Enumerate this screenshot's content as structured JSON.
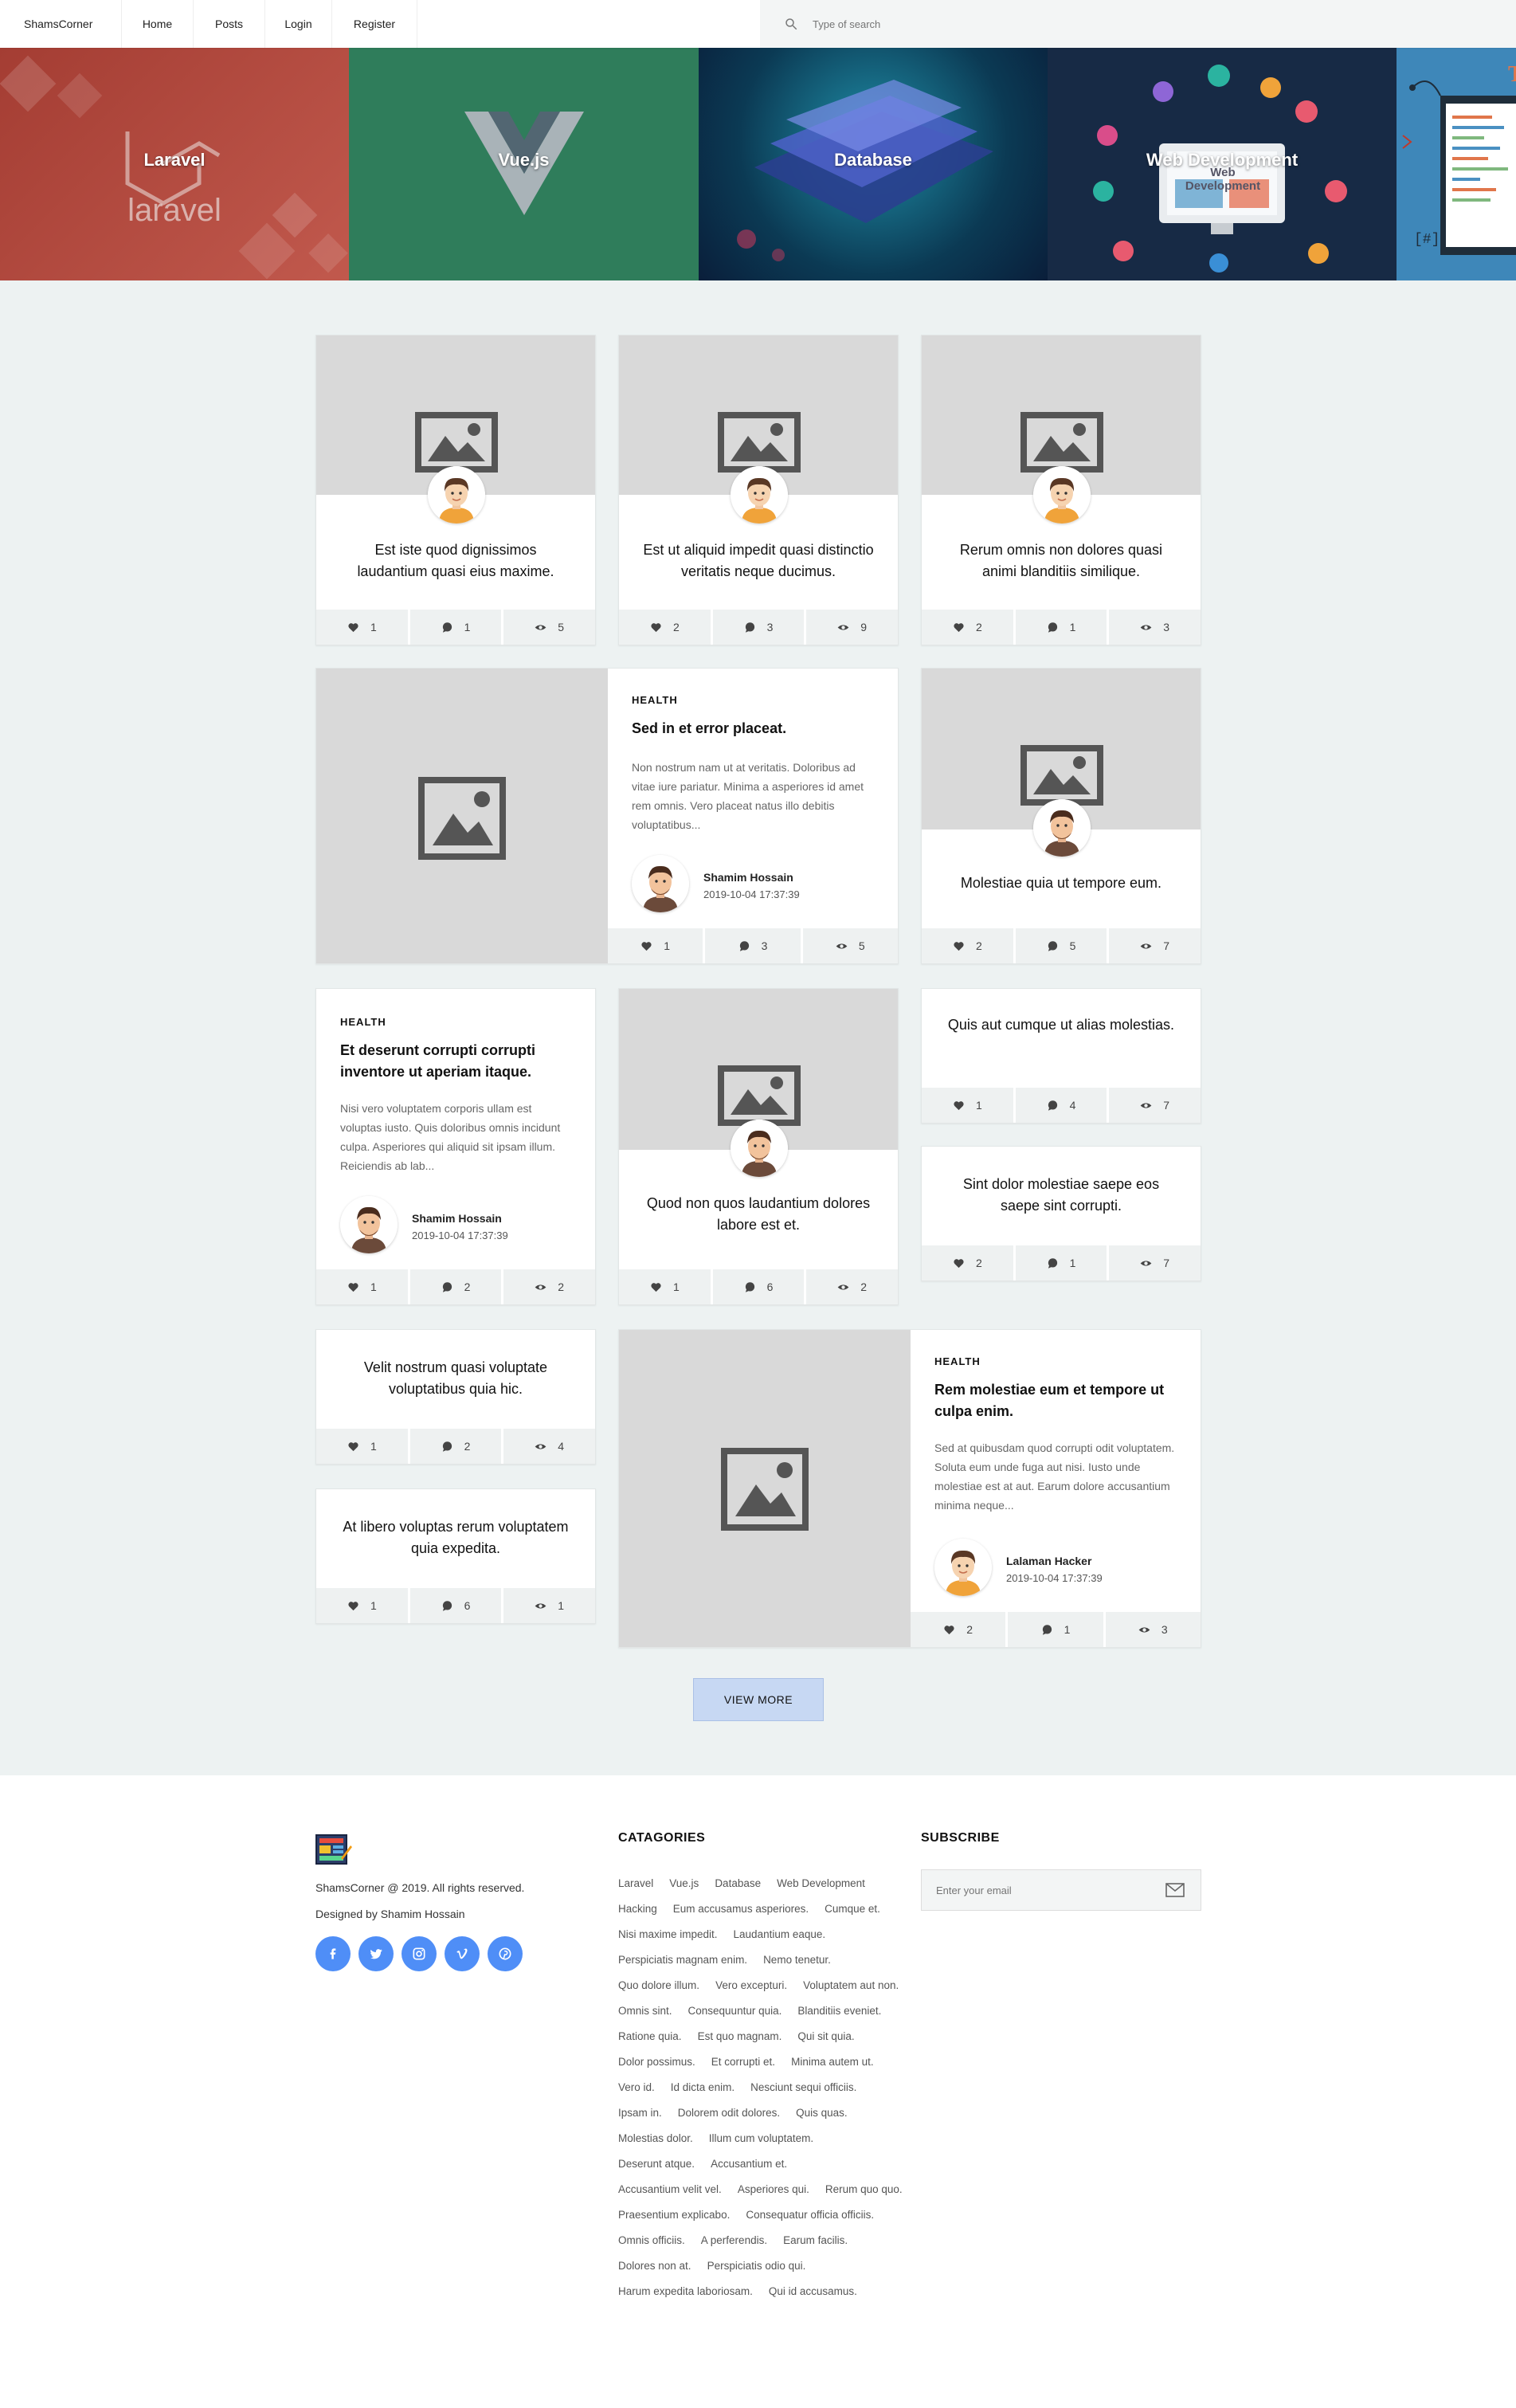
{
  "nav": {
    "brand": "ShamsCorner",
    "items": [
      "Home",
      "Posts",
      "Login",
      "Register"
    ],
    "search_placeholder": "Type of search"
  },
  "hero": {
    "tiles": [
      {
        "label": "Laravel",
        "logo_text": "laravel"
      },
      {
        "label": "Vue.js"
      },
      {
        "label": "Database"
      },
      {
        "label": "Web Development",
        "screen_text": "Web Development"
      },
      {
        "label": ""
      }
    ]
  },
  "posts": [
    {
      "title": "Est iste quod dignissimos laudantium quasi eius maxime.",
      "likes": "1",
      "comments": "1",
      "views": "5"
    },
    {
      "title": "Est ut aliquid impedit quasi distinctio veritatis neque ducimus.",
      "likes": "2",
      "comments": "3",
      "views": "9"
    },
    {
      "title": "Rerum omnis non dolores quasi animi blanditiis similique.",
      "likes": "2",
      "comments": "1",
      "views": "3"
    },
    {
      "category": "HEALTH",
      "title": "Sed in et error placeat.",
      "excerpt": "Non nostrum nam ut at veritatis. Doloribus ad vitae iure pariatur. Minima a asperiores id amet rem omnis. Vero placeat natus illo debitis voluptatibus...",
      "author": "Shamim Hossain",
      "date": "2019-10-04 17:37:39",
      "likes": "1",
      "comments": "3",
      "views": "5"
    },
    {
      "title": "Molestiae quia ut tempore eum.",
      "likes": "2",
      "comments": "5",
      "views": "7"
    },
    {
      "category": "HEALTH",
      "title": "Et deserunt corrupti corrupti inventore ut aperiam itaque.",
      "excerpt": "Nisi vero voluptatem corporis ullam est voluptas iusto. Quis doloribus omnis incidunt culpa. Asperiores qui aliquid sit ipsam illum. Reiciendis ab lab...",
      "author": "Shamim Hossain",
      "date": "2019-10-04 17:37:39",
      "likes": "1",
      "comments": "2",
      "views": "2"
    },
    {
      "title": "Quod non quos laudantium dolores labore est et.",
      "likes": "1",
      "comments": "6",
      "views": "2"
    },
    {
      "title": "Quis aut cumque ut alias molestias.",
      "likes": "1",
      "comments": "4",
      "views": "7"
    },
    {
      "title": "Sint dolor molestiae saepe eos saepe sint corrupti.",
      "likes": "2",
      "comments": "1",
      "views": "7"
    },
    {
      "title": "Velit nostrum quasi voluptate voluptatibus quia hic.",
      "likes": "1",
      "comments": "2",
      "views": "4"
    },
    {
      "title": "At libero voluptas rerum voluptatem quia expedita.",
      "likes": "1",
      "comments": "6",
      "views": "1"
    },
    {
      "category": "HEALTH",
      "title": "Rem molestiae eum et tempore ut culpa enim.",
      "excerpt": "Sed at quibusdam quod corrupti odit voluptatem. Soluta eum unde fuga aut nisi. Iusto unde molestiae est at aut. Earum dolore accusantium minima neque...",
      "author": "Lalaman Hacker",
      "date": "2019-10-04 17:37:39",
      "likes": "2",
      "comments": "1",
      "views": "3"
    }
  ],
  "view_more_label": "VIEW MORE",
  "footer": {
    "copyright": "ShamsCorner @ 2019. All rights reserved.",
    "designed_by": "Designed by Shamim Hossain",
    "social_icons": [
      "facebook-icon",
      "twitter-icon",
      "instagram-icon",
      "vimeo-icon",
      "pinterest-icon"
    ],
    "categories_heading": "CATAGORIES",
    "categories": [
      "Laravel",
      "Vue.js",
      "Database",
      "Web Development",
      "Hacking",
      "Eum accusamus asperiores.",
      "Cumque et.",
      "Nisi maxime impedit.",
      "Laudantium eaque.",
      "Perspiciatis magnam enim.",
      "Nemo tenetur.",
      "Quo dolore illum.",
      "Vero excepturi.",
      "Voluptatem aut non.",
      "Omnis sint.",
      "Consequuntur quia.",
      "Blanditiis eveniet.",
      "Ratione quia.",
      "Est quo magnam.",
      "Qui sit quia.",
      "Dolor possimus.",
      "Et corrupti et.",
      "Minima autem ut.",
      "Vero id.",
      "Id dicta enim.",
      "Nesciunt sequi officiis.",
      "Ipsam in.",
      "Dolorem odit dolores.",
      "Quis quas.",
      "Molestias dolor.",
      "Illum cum voluptatem.",
      "Deserunt atque.",
      "Accusantium et.",
      "Accusantium velit vel.",
      "Asperiores qui.",
      "Rerum quo quo.",
      "Praesentium explicabo.",
      "Consequatur officia officiis.",
      "Omnis officiis.",
      "A perferendis.",
      "Earum facilis.",
      "Dolores non at.",
      "Perspiciatis odio qui.",
      "Harum expedita laboriosam.",
      "Qui id accusamus."
    ],
    "subscribe_heading": "SUBSCRIBE",
    "email_placeholder": "Enter your email"
  },
  "colors": {
    "accent_blue": "#4f8ef7",
    "view_more_bg": "#c7d8f3",
    "page_bg": "#edf2f2",
    "laravel_tile": "#b0443a",
    "vue_tile": "#2f7d5b"
  }
}
